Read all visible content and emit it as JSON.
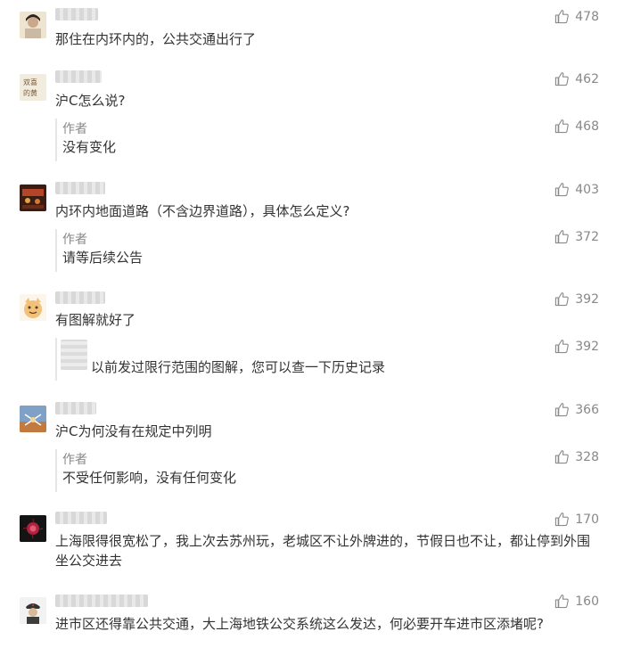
{
  "comments": [
    {
      "text": "那住在内环内的，公共交通出行了",
      "likes": "478"
    },
    {
      "text": "沪C怎么说?",
      "likes": "462",
      "reply": {
        "author": "作者",
        "text": "没有变化",
        "likes": "468"
      }
    },
    {
      "text": "内环内地面道路（不含边界道路），具体怎么定义?",
      "likes": "403",
      "reply": {
        "author": "作者",
        "text": "请等后续公告",
        "likes": "372"
      }
    },
    {
      "text": "有图解就好了",
      "likes": "392",
      "reply": {
        "author": "",
        "text": "以前发过限行范围的图解，您可以查一下历史记录",
        "likes": "392"
      }
    },
    {
      "text": "沪C为何没有在规定中列明",
      "likes": "366",
      "reply": {
        "author": "作者",
        "text": "不受任何影响，没有任何变化",
        "likes": "328"
      }
    },
    {
      "text": "上海限得很宽松了，我上次去苏州玩，老城区不让外牌进的，节假日也不让，都让停到外围坐公交进去",
      "likes": "170"
    },
    {
      "text": "进市区还得靠公共交通，大上海地铁公交系统这么发达，何必要开车进市区添堵呢?",
      "likes": "160"
    }
  ],
  "icons": {
    "like": "thumbs-up-icon"
  },
  "colors": {
    "text": "#333333",
    "meta": "#888888",
    "divider": "#e6e6e6"
  }
}
